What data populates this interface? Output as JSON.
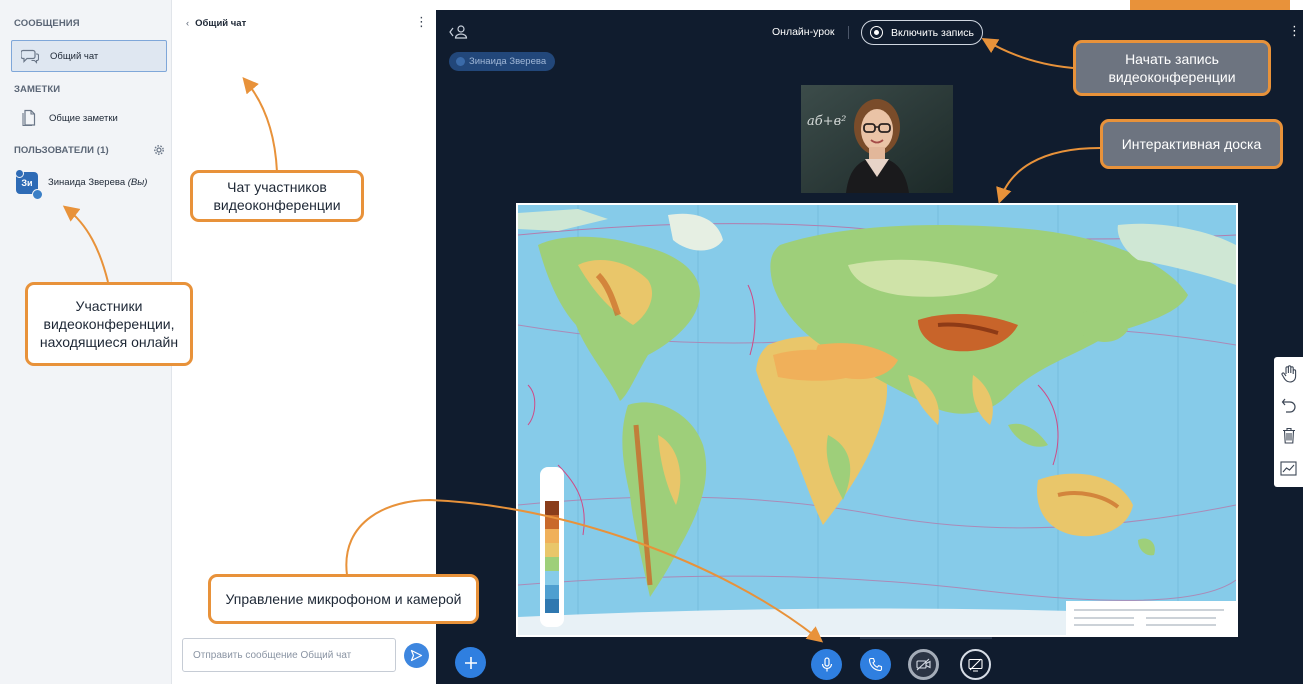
{
  "left_panel": {
    "messages_heading": "СООБЩЕНИЯ",
    "general_chat": "Общий чат",
    "notes_heading": "ЗАМЕТКИ",
    "general_notes": "Общие заметки",
    "users_heading": "ПОЛЬЗОВАТЕЛИ (1)",
    "user": {
      "initials": "Зи",
      "name": "Зинаида Зверева",
      "you": "(Вы)"
    }
  },
  "chat": {
    "title": "Общий чат",
    "input_placeholder": "Отправить сообщение Общий чат"
  },
  "conference": {
    "mode_label": "Онлайн-урок",
    "record_button": "Включить запись",
    "presenter_pill": "Зинаида Зверева",
    "video_board_text": "аб+в²"
  },
  "annotations": {
    "chat_participants": "Чат участников видеоконференции",
    "online_participants": "Участники видеоконференции, находящиеся онлайн",
    "mic_camera": "Управление микрофоном и камерой",
    "start_recording": "Начать запись видеоконференции",
    "whiteboard": "Интерактивная доска"
  },
  "icons": {
    "chat": "chat-bubble-icon",
    "notes": "document-icon",
    "settings": "gear-icon",
    "hand": "hand-pointer-icon",
    "undo": "undo-icon",
    "trash": "trash-icon",
    "chart": "line-chart-icon",
    "send": "send-icon",
    "plus": "plus-icon",
    "mic": "microphone-icon",
    "phone": "phone-icon",
    "camera": "camera-off-icon",
    "screen": "screen-share-off-icon"
  },
  "colors": {
    "accent": "#2f7fe0",
    "callout_border": "#e8923a",
    "main_background": "#101c2e",
    "side_panel": "#f2f4f7"
  }
}
